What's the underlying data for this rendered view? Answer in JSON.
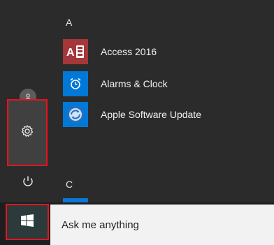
{
  "start_menu": {
    "sections": [
      {
        "letter": "A"
      },
      {
        "letter": "C"
      }
    ],
    "apps": [
      {
        "label": "Access 2016",
        "icon": "access-icon",
        "tile_color": "#a4373a"
      },
      {
        "label": "Alarms & Clock",
        "icon": "alarm-clock-icon",
        "tile_color": "#0078d7"
      },
      {
        "label": "Apple Software Update",
        "icon": "apple-software-update-icon",
        "tile_color": "#0078d7"
      }
    ],
    "rail": {
      "account_icon": "user-icon",
      "settings_icon": "gear-icon",
      "power_icon": "power-icon",
      "settings_highlight_color": "#e8131d"
    }
  },
  "taskbar": {
    "start_icon": "windows-logo-icon",
    "search_placeholder": "Ask me anything",
    "start_highlight_color": "#e8131d"
  }
}
